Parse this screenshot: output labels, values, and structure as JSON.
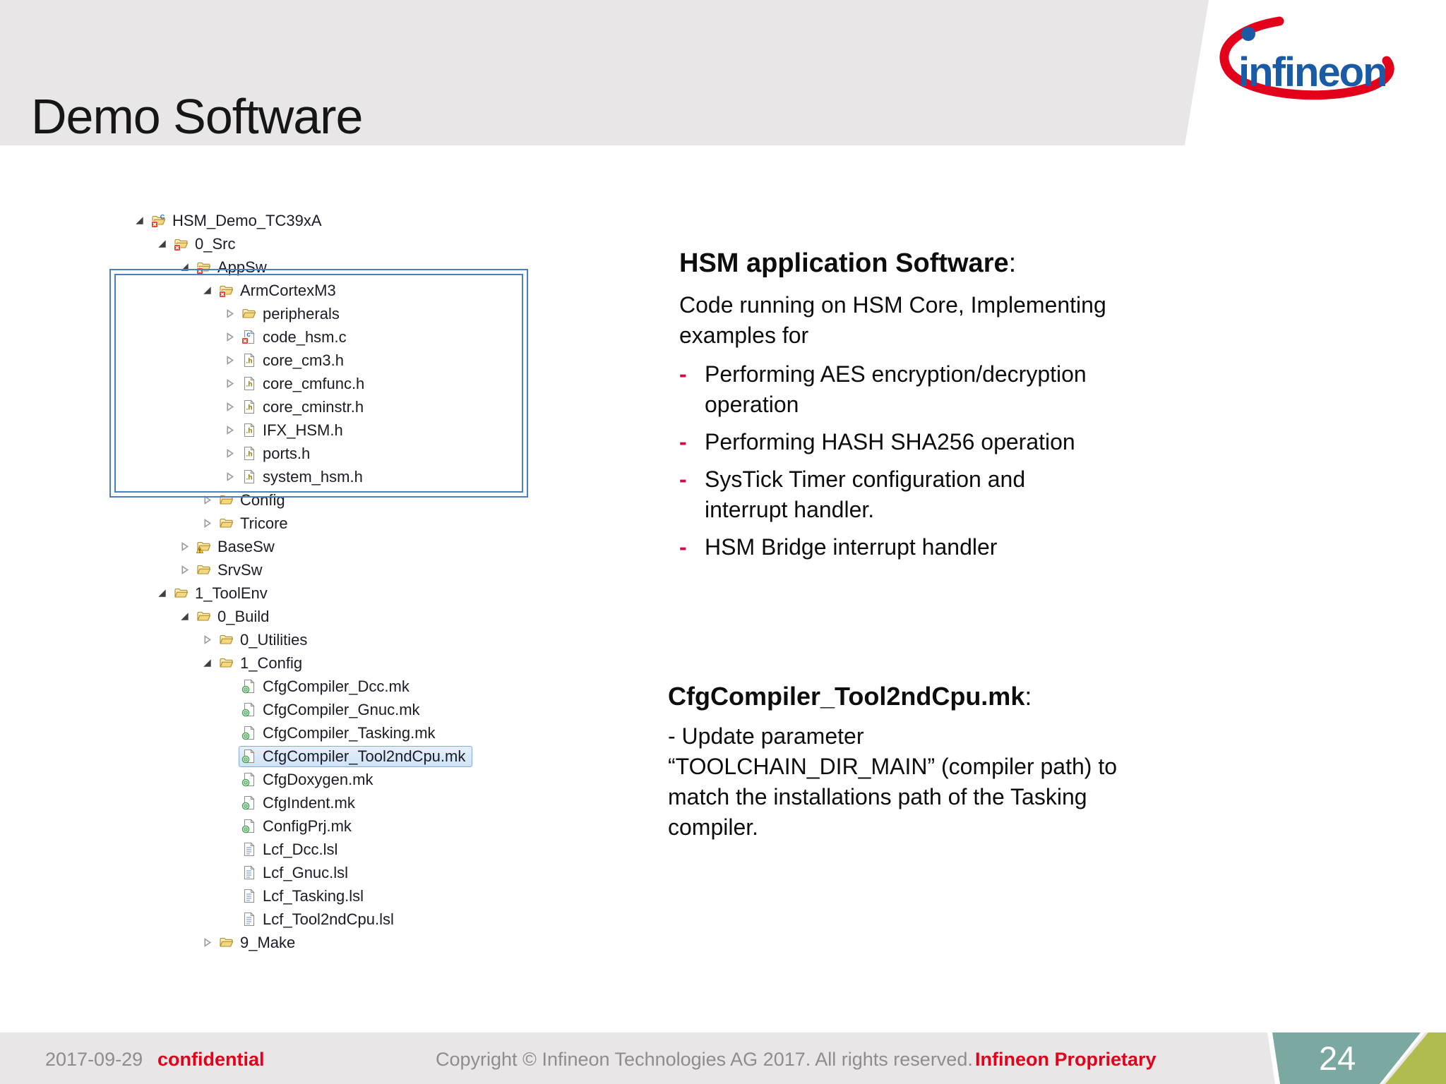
{
  "slide": {
    "title": "Demo Software"
  },
  "logo": {
    "brand": "infineon"
  },
  "colors": {
    "infineon_red": "#e2001a",
    "infineon_blue": "#1a5ba6",
    "bullet_red": "#c8104c",
    "header_gray": "#e9e6e7",
    "badge_teal": "#7ba9a2",
    "badge_olive": "#b0bd4e",
    "highlight_blue": "#4a80c0"
  },
  "tree": {
    "rows": [
      {
        "label": "HSM_Demo_TC39xA",
        "level": 0,
        "arrow": "expanded",
        "icon": "c-project-icon",
        "selected": false
      },
      {
        "label": "0_Src",
        "level": 1,
        "arrow": "expanded",
        "icon": "folder-conflict-icon",
        "selected": false
      },
      {
        "label": "AppSw",
        "level": 2,
        "arrow": "expanded",
        "icon": "folder-conflict-icon",
        "selected": false
      },
      {
        "label": "ArmCortexM3",
        "level": 3,
        "arrow": "expanded",
        "icon": "folder-conflict-icon",
        "selected": false
      },
      {
        "label": "peripherals",
        "level": 4,
        "arrow": "collapsed",
        "icon": "folder-icon",
        "selected": false
      },
      {
        "label": "code_hsm.c",
        "level": 4,
        "arrow": "collapsed",
        "icon": "c-file-conflict-icon",
        "selected": false
      },
      {
        "label": "core_cm3.h",
        "level": 4,
        "arrow": "collapsed",
        "icon": "h-file-icon",
        "selected": false
      },
      {
        "label": "core_cmfunc.h",
        "level": 4,
        "arrow": "collapsed",
        "icon": "h-file-icon",
        "selected": false
      },
      {
        "label": "core_cminstr.h",
        "level": 4,
        "arrow": "collapsed",
        "icon": "h-file-icon",
        "selected": false
      },
      {
        "label": "IFX_HSM.h",
        "level": 4,
        "arrow": "collapsed",
        "icon": "h-file-icon",
        "selected": false
      },
      {
        "label": "ports.h",
        "level": 4,
        "arrow": "collapsed",
        "icon": "h-file-icon",
        "selected": false
      },
      {
        "label": "system_hsm.h",
        "level": 4,
        "arrow": "collapsed",
        "icon": "h-file-icon",
        "selected": false
      },
      {
        "label": "Config",
        "level": 3,
        "arrow": "collapsed",
        "icon": "folder-icon",
        "selected": false
      },
      {
        "label": "Tricore",
        "level": 3,
        "arrow": "collapsed",
        "icon": "folder-icon",
        "selected": false
      },
      {
        "label": "BaseSw",
        "level": 2,
        "arrow": "collapsed",
        "icon": "folder-warning-icon",
        "selected": false
      },
      {
        "label": "SrvSw",
        "level": 2,
        "arrow": "collapsed",
        "icon": "folder-icon",
        "selected": false
      },
      {
        "label": "1_ToolEnv",
        "level": 1,
        "arrow": "expanded",
        "icon": "folder-icon",
        "selected": false
      },
      {
        "label": "0_Build",
        "level": 2,
        "arrow": "expanded",
        "icon": "folder-icon",
        "selected": false
      },
      {
        "label": "0_Utilities",
        "level": 3,
        "arrow": "collapsed",
        "icon": "folder-icon",
        "selected": false
      },
      {
        "label": "1_Config",
        "level": 3,
        "arrow": "expanded",
        "icon": "folder-icon",
        "selected": false
      },
      {
        "label": "CfgCompiler_Dcc.mk",
        "level": 4,
        "arrow": "none",
        "icon": "makefile-icon",
        "selected": false
      },
      {
        "label": "CfgCompiler_Gnuc.mk",
        "level": 4,
        "arrow": "none",
        "icon": "makefile-icon",
        "selected": false
      },
      {
        "label": "CfgCompiler_Tasking.mk",
        "level": 4,
        "arrow": "none",
        "icon": "makefile-icon",
        "selected": false
      },
      {
        "label": "CfgCompiler_Tool2ndCpu.mk",
        "level": 4,
        "arrow": "none",
        "icon": "makefile-icon",
        "selected": true
      },
      {
        "label": "CfgDoxygen.mk",
        "level": 4,
        "arrow": "none",
        "icon": "makefile-icon",
        "selected": false
      },
      {
        "label": "CfgIndent.mk",
        "level": 4,
        "arrow": "none",
        "icon": "makefile-icon",
        "selected": false
      },
      {
        "label": "ConfigPrj.mk",
        "level": 4,
        "arrow": "none",
        "icon": "makefile-icon",
        "selected": false
      },
      {
        "label": "Lcf_Dcc.lsl",
        "level": 4,
        "arrow": "none",
        "icon": "text-file-icon",
        "selected": false
      },
      {
        "label": "Lcf_Gnuc.lsl",
        "level": 4,
        "arrow": "none",
        "icon": "text-file-icon",
        "selected": false
      },
      {
        "label": "Lcf_Tasking.lsl",
        "level": 4,
        "arrow": "none",
        "icon": "text-file-icon",
        "selected": false
      },
      {
        "label": "Lcf_Tool2ndCpu.lsl",
        "level": 4,
        "arrow": "none",
        "icon": "text-file-icon",
        "selected": false
      },
      {
        "label": "9_Make",
        "level": 3,
        "arrow": "collapsed",
        "icon": "folder-icon",
        "selected": false
      }
    ]
  },
  "content": {
    "section1": {
      "heading": "HSM application Software",
      "heading_colon": ":",
      "intro_lines": [
        "Code running on HSM Core, Implementing",
        "examples for"
      ],
      "bullet_marker": "-",
      "bullets": [
        {
          "lines": [
            "Performing AES encryption/decryption",
            "operation"
          ]
        },
        {
          "lines": [
            "Performing HASH SHA256 operation"
          ]
        },
        {
          "lines": [
            "SysTick Timer configuration and",
            "interrupt handler."
          ]
        },
        {
          "lines": [
            "HSM Bridge interrupt handler"
          ]
        }
      ]
    },
    "section2": {
      "heading": "CfgCompiler_Tool2ndCpu.mk",
      "heading_colon": ":",
      "body_lines": [
        "- Update parameter",
        "“TOOLCHAIN_DIR_MAIN” (compiler path) to",
        "match the installations path of the Tasking",
        "compiler."
      ]
    }
  },
  "footer": {
    "date": "2017-09-29",
    "classification": "confidential",
    "copyright": "Copyright © Infineon Technologies AG 2017. All rights reserved.",
    "proprietary": "Infineon Proprietary",
    "page_number": "24"
  }
}
